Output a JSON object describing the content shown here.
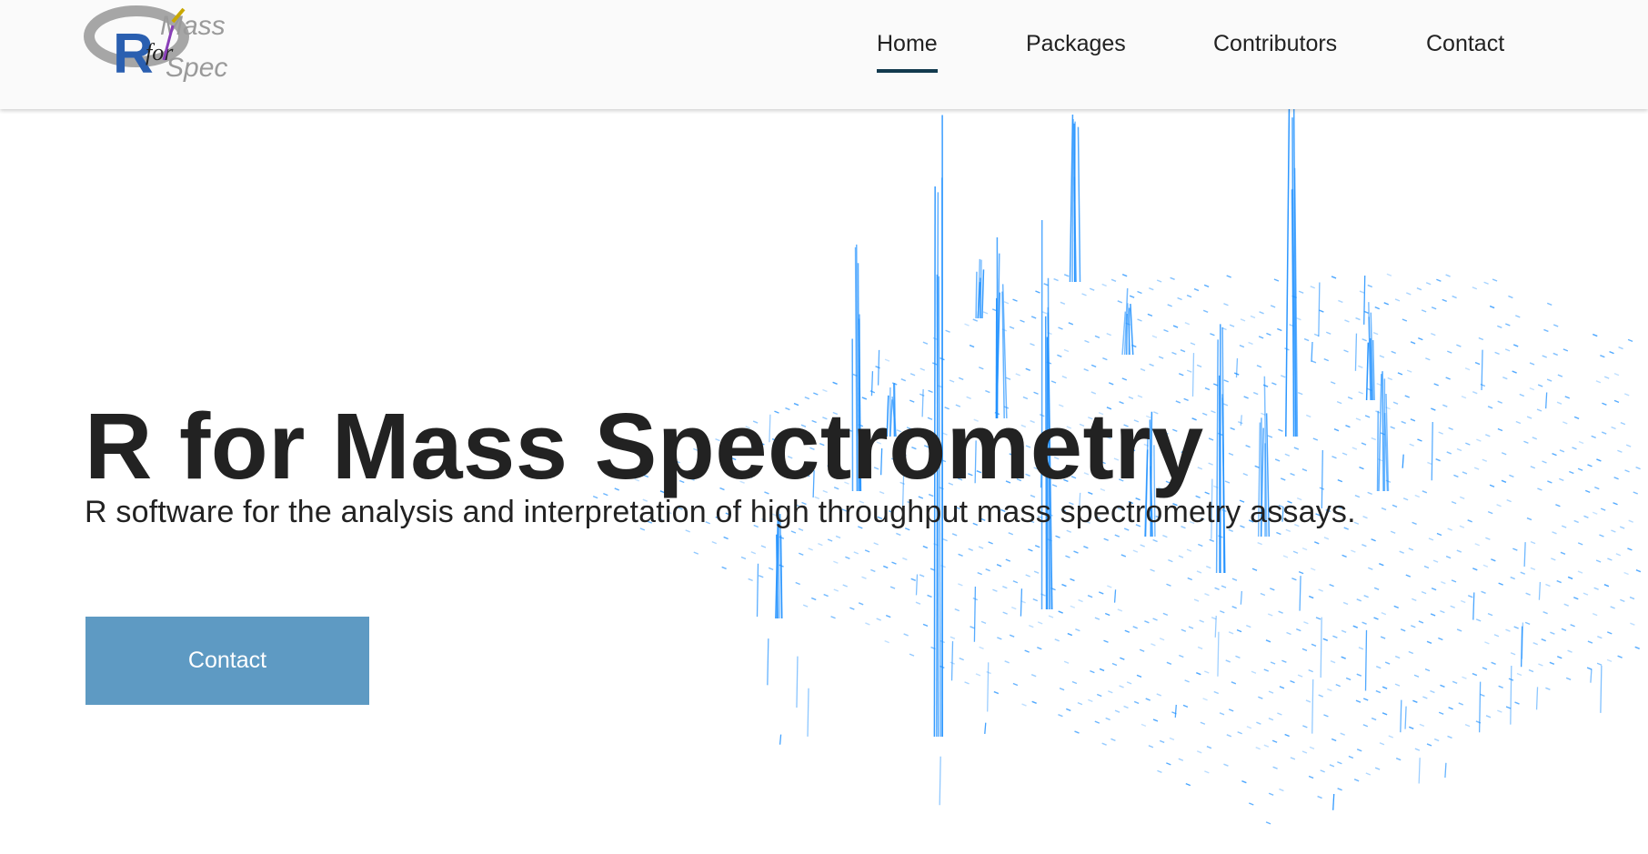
{
  "brand": {
    "logo_letter_r": "R",
    "logo_for": "for",
    "logo_mass": "Mass",
    "logo_spec": "Spec"
  },
  "nav": {
    "items": [
      {
        "label": "Home",
        "active": true
      },
      {
        "label": "Packages",
        "active": false
      },
      {
        "label": "Contributors",
        "active": false
      },
      {
        "label": "Contact",
        "active": false
      }
    ]
  },
  "hero": {
    "title": "R for Mass Spectrometry",
    "subtitle": "R software for the analysis and interpretation of high throughput mass spectrometry assays.",
    "cta_label": "Contact"
  },
  "colors": {
    "accent": "#5e9ac3",
    "active_underline": "#123a4e",
    "spectrum": "#1e90ff",
    "navbar_bg": "#fafafa"
  }
}
